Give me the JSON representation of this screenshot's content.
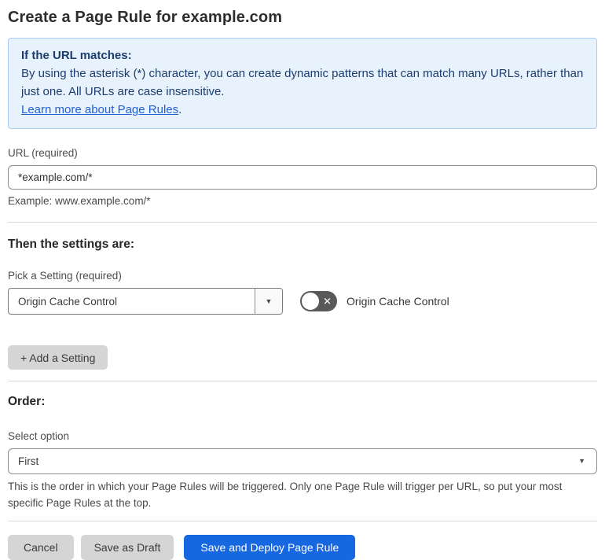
{
  "page": {
    "title": "Create a Page Rule for example.com"
  },
  "info_box": {
    "heading": "If the URL matches:",
    "body": "By using the asterisk (*) character, you can create dynamic patterns that can match many URLs, rather than just one. All URLs are case insensitive.",
    "link_label": "Learn more about Page Rules",
    "link_suffix": "."
  },
  "url_field": {
    "label": "URL (required)",
    "value": "*example.com/*",
    "example": "Example: www.example.com/*"
  },
  "settings_section": {
    "heading": "Then the settings are:",
    "picker_label": "Pick a Setting (required)",
    "picker_value": "Origin Cache Control",
    "toggle_label": "Origin Cache Control",
    "toggle_state": "off",
    "add_button_label": "+ Add a Setting"
  },
  "order_section": {
    "heading": "Order:",
    "select_label": "Select option",
    "select_value": "First",
    "help": "This is the order in which your Page Rules will be triggered. Only one Page Rule will trigger per URL, so put your most specific Page Rules at the top."
  },
  "footer": {
    "cancel_label": "Cancel",
    "save_draft_label": "Save as Draft",
    "save_deploy_label": "Save and Deploy Page Rule"
  },
  "icons": {
    "dropdown_caret": "▼",
    "toggle_off_x": "✕"
  },
  "colors": {
    "info_bg": "#e8f2fc",
    "info_border": "#a9cdf1",
    "info_text": "#1b3d6d",
    "link_blue": "#2360d6",
    "primary_blue": "#1667e0",
    "toggle_off_gray": "#595959",
    "button_gray": "#d5d5d5"
  }
}
